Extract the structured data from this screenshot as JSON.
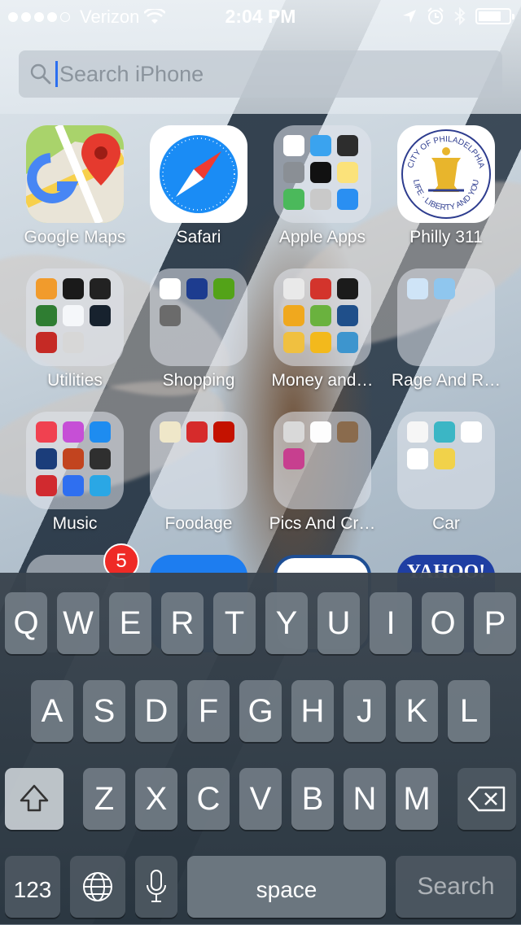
{
  "status_bar": {
    "carrier": "Verizon",
    "time": "2:04 PM",
    "signal_bars": 4,
    "battery_level": 0.75
  },
  "search": {
    "placeholder": "Search iPhone"
  },
  "apps": {
    "google_maps": "Google Maps",
    "safari": "Safari",
    "apple_apps": "Apple Apps",
    "philly_311": "Philly 311",
    "utilities": "Utilities",
    "shopping": "Shopping",
    "money": "Money and…",
    "rage": "Rage And R…",
    "music": "Music",
    "foodage": "Foodage",
    "pics": "Pics And Cr…",
    "car": "Car"
  },
  "philly_seal": {
    "top_text": "CITY OF PHILADELPHIA",
    "bottom_text": "LIFE · LIBERTY AND YOU"
  },
  "badge": "5",
  "partial_icon_text": "YAHOO!",
  "keyboard": {
    "row1": [
      "Q",
      "W",
      "E",
      "R",
      "T",
      "Y",
      "U",
      "I",
      "O",
      "P"
    ],
    "row2": [
      "A",
      "S",
      "D",
      "F",
      "G",
      "H",
      "J",
      "K",
      "L"
    ],
    "row3": [
      "Z",
      "X",
      "C",
      "V",
      "B",
      "N",
      "M"
    ],
    "numbers": "123",
    "space": "space",
    "search": "Search"
  },
  "colors": {
    "caret": "#2b6ff0",
    "badge": "#ef2a26",
    "safari_blue": "#1a8cf5"
  }
}
